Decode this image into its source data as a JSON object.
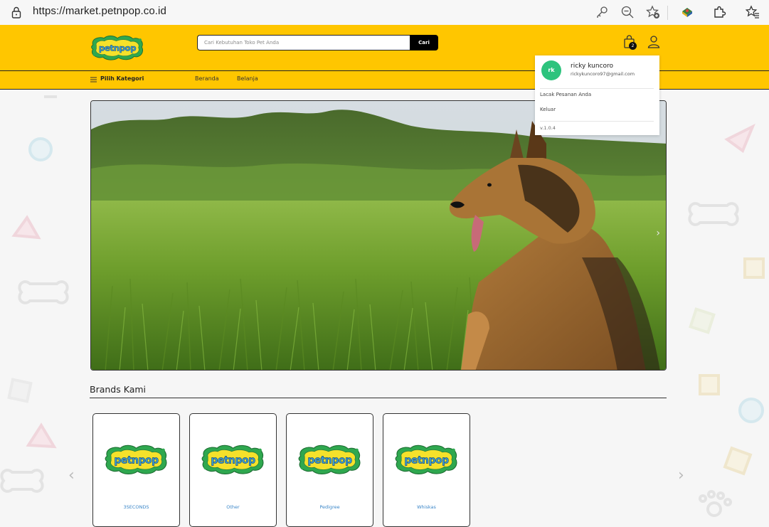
{
  "browser": {
    "url": "https://market.petnpop.co.id"
  },
  "header": {
    "logo_text": "PETNPOP",
    "search": {
      "placeholder": "Cari Kebutuhan Toko Pet Anda",
      "button_label": "Cari"
    },
    "cart_count": "2"
  },
  "nav": {
    "category_label": "Pilih Kategori",
    "links": [
      "Beranda",
      "Belanja"
    ]
  },
  "user_menu": {
    "avatar_initials": "rk",
    "name": "ricky kuncoro",
    "email": "rickykuncoro97@gmail.com",
    "items": [
      "Lacak Pesanan Anda",
      "Keluar"
    ],
    "version": "v.1.0.4"
  },
  "hero": {
    "next_arrow": "›"
  },
  "brands": {
    "title": "Brands Kami",
    "items": [
      "3SECONDS",
      "Other",
      "Pedigree",
      "Whiskas"
    ],
    "prev_arrow": "‹",
    "next_arrow": "›"
  },
  "colors": {
    "brand_yellow": "#ffc600",
    "avatar_green": "#2dc37d",
    "link_blue": "#3a86c8"
  }
}
